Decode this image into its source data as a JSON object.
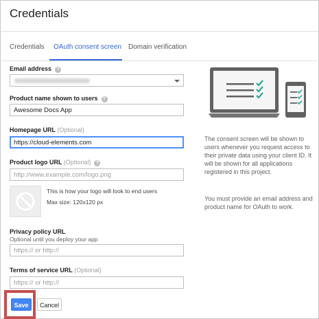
{
  "header": {
    "title": "Credentials"
  },
  "tabs": [
    {
      "label": "Credentials",
      "active": false
    },
    {
      "label": "OAuth consent screen",
      "active": true
    },
    {
      "label": "Domain verification",
      "active": false
    }
  ],
  "form": {
    "email": {
      "label": "Email address",
      "value": ""
    },
    "product_name": {
      "label": "Product name shown to users",
      "value": "Awesome Docs App"
    },
    "homepage": {
      "label": "Homepage URL",
      "optional": "(Optional)",
      "value": "https://cloud-elements.com"
    },
    "logo": {
      "label": "Product logo URL",
      "optional": "(Optional)",
      "placeholder": "http://www.example.com/logo.png",
      "note": "This is how your logo will look to end users",
      "size": "Max size: 120x120 px"
    },
    "privacy": {
      "label": "Privacy policy URL",
      "sublabel": "Optional until you deploy your app",
      "placeholder": "https:// or http://"
    },
    "terms": {
      "label": "Terms of service URL",
      "optional": "(Optional)",
      "placeholder": "https:// or http://"
    }
  },
  "side": {
    "description": "The consent screen will be shown to users whenever you request access to their private data using your client ID. It will be shown for all applications registered in this project.",
    "requirement": "You must provide an email address and product name for OAuth to work."
  },
  "actions": {
    "save_label": "Save",
    "cancel_label": "Cancel"
  },
  "colors": {
    "accent": "#3367d6",
    "button": "#4285f4",
    "highlight": "#c44f4f",
    "teal": "#26a69a"
  }
}
